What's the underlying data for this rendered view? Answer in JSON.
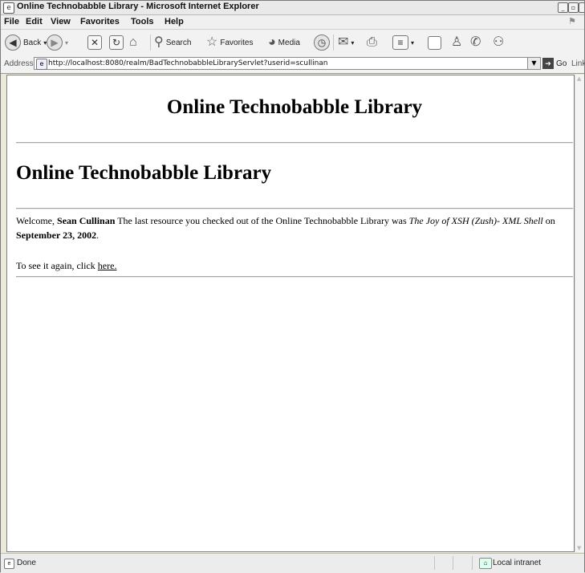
{
  "window": {
    "title": "Online Technobabble Library - Microsoft Internet Explorer",
    "controls": [
      "minimize",
      "restore",
      "close"
    ]
  },
  "menubar": {
    "items": [
      "File",
      "Edit",
      "View",
      "Favorites",
      "Tools",
      "Help"
    ]
  },
  "toolbar": {
    "back_label": "Back",
    "search_label": "Search",
    "favorites_label": "Favorites",
    "media_label": "Media"
  },
  "address": {
    "label": "Address",
    "url": "http://localhost:8080/realm/BadTechnobabbleLibraryServlet?userid=scullinan",
    "go_label": "Go",
    "links_label": "Links"
  },
  "page": {
    "heading_center": "Online Technobabble Library",
    "heading_left": "Online Technobabble Library",
    "welcome_prefix": "Welcome,",
    "user_name": "Sean Cullinan",
    "message_middle": "The last resource you checked out of the Online Technobabble Library was",
    "resource_title": "The Joy of XSH (Zush)- XML Shell",
    "date_prefix": "on",
    "checkout_date": "September 23, 2002",
    "date_suffix": ".",
    "see_again_text": "To see it again, click",
    "link_text": "here."
  },
  "statusbar": {
    "status": "Done",
    "zone": "Local intranet"
  }
}
